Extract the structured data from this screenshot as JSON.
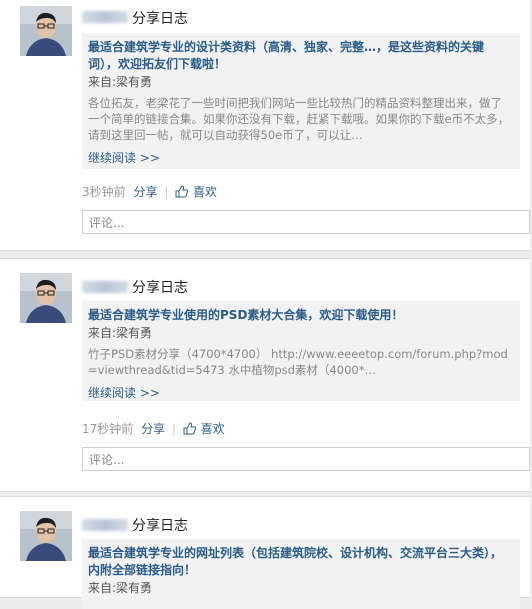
{
  "posts": [
    {
      "action": "分享日志",
      "title": "最适合建筑学专业的设计类资料（高清、独家、完整…，是这些资料的关键词），欢迎拓友们下载啦！",
      "from_label": "来自:",
      "author": "梁有勇",
      "body": "各位拓友，老梁花了一些时间把我们网站一些比较热门的精品资料整理出来，做了一个简单的链接合集。如果你还没有下载，赶紧下载哦。如果你的下载e币不太多，请到这里回一帖，就可以自动获得50e币了，可以让…",
      "read_more": "继续阅读 >>",
      "time": "3秒钟前",
      "share": "分享",
      "like": "喜欢",
      "comment_placeholder": "评论..."
    },
    {
      "action": "分享日志",
      "title": "最适合建筑学专业使用的PSD素材大合集，欢迎下载使用！",
      "from_label": "来自:",
      "author": "梁有勇",
      "body": "竹子PSD素材分享（4700*4700） http://www.eeeetop.com/forum.php?mod=viewthread&tid=5473 水中植物psd素材（4000*…",
      "read_more": "继续阅读 >>",
      "time": "17秒钟前",
      "share": "分享",
      "like": "喜欢",
      "comment_placeholder": "评论..."
    },
    {
      "action": "分享日志",
      "title": "最适合建筑学专业的网址列表（包括建筑院校、设计机构、交流平台三大类），内附全部链接指向！",
      "from_label": "来自:",
      "author": "梁有勇"
    }
  ]
}
